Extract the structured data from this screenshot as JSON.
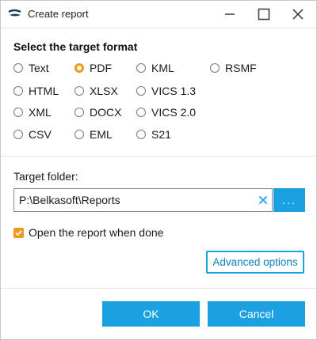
{
  "window": {
    "title": "Create report"
  },
  "format": {
    "heading": "Select the target format",
    "options": [
      "Text",
      "PDF",
      "KML",
      "RSMF",
      "HTML",
      "XLSX",
      "VICS 1.3",
      "XML",
      "DOCX",
      "VICS 2.0",
      "CSV",
      "EML",
      "S21"
    ],
    "selected": "PDF"
  },
  "folder": {
    "label": "Target folder:",
    "path": "P:\\Belkasoft\\Reports",
    "browse_label": "..."
  },
  "open_when_done": {
    "label": "Open the report when done",
    "checked": true
  },
  "buttons": {
    "advanced": "Advanced options",
    "ok": "OK",
    "cancel": "Cancel"
  },
  "colors": {
    "accent": "#1ba1e2",
    "selection": "#f39a1e"
  }
}
